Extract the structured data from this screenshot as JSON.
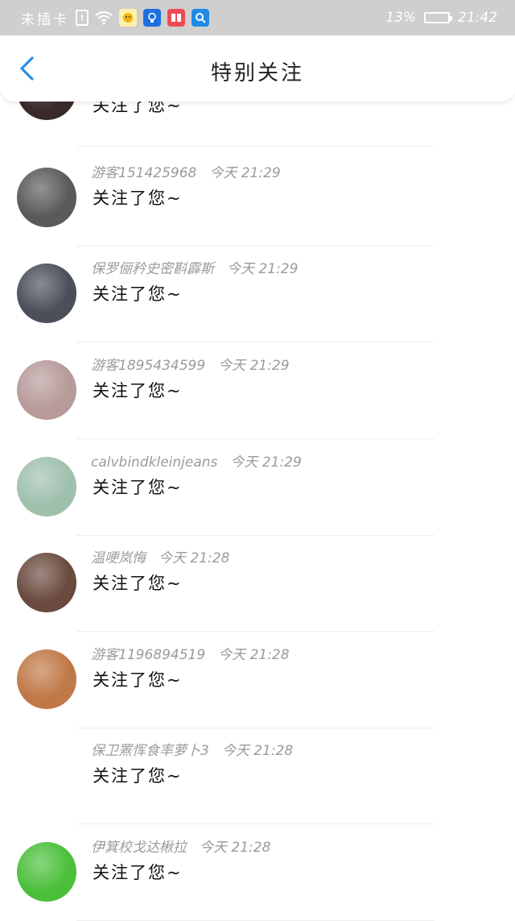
{
  "status_bar": {
    "carrier": "未插卡",
    "battery_percent": "13%",
    "time": "21:42",
    "icons": [
      "sim-alert-icon",
      "wifi-icon",
      "app-notification-icon",
      "lightbulb-app-icon",
      "book-app-icon",
      "search-app-icon",
      "battery-charging-icon"
    ]
  },
  "header": {
    "title": "特别关注",
    "back_icon": "chevron-left-icon"
  },
  "items": [
    {
      "name": "",
      "time": "",
      "message": "关注了您~",
      "avatar_color": "#3a2a2a"
    },
    {
      "name": "游客151425968",
      "time": "今天 21:29",
      "message": "关注了您~",
      "avatar_color": "#5a5a5a"
    },
    {
      "name": "保罗俪矜史密斟霹斯",
      "time": "今天 21:29",
      "message": "关注了您~",
      "avatar_color": "#4a4f5a"
    },
    {
      "name": "游客1895434599",
      "time": "今天 21:29",
      "message": "关注了您~",
      "avatar_color": "#b79a9a"
    },
    {
      "name": "calvbindkleinjeans",
      "time": "今天 21:29",
      "message": "关注了您~",
      "avatar_color": "#9fc0ad"
    },
    {
      "name": "温哽岚悔",
      "time": "今天 21:28",
      "message": "关注了您~",
      "avatar_color": "#6a4a3e"
    },
    {
      "name": "游客1196894519",
      "time": "今天 21:28",
      "message": "关注了您~",
      "avatar_color": "#c07846"
    },
    {
      "name": "保卫罴恽食率萝卜3",
      "time": "今天 21:28",
      "message": "关注了您~",
      "avatar_color": ""
    },
    {
      "name": "伊箕校戈达楸拉",
      "time": "今天 21:28",
      "message": "关注了您~",
      "avatar_color": "#4bbf3a"
    }
  ]
}
